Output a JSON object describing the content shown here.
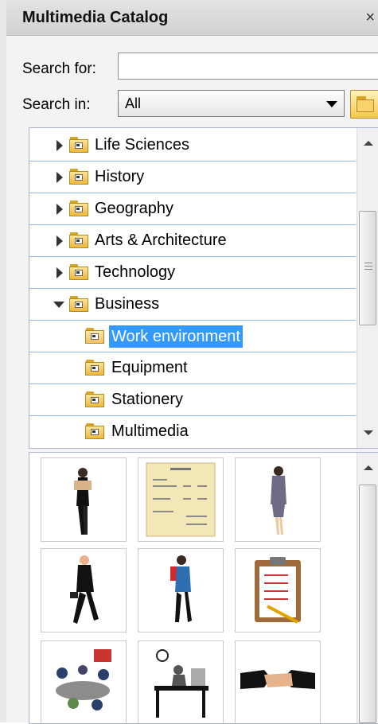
{
  "panel": {
    "title": "Multimedia Catalog",
    "close_icon": "close-icon"
  },
  "search": {
    "label": "Search for:",
    "value": "",
    "placeholder": ""
  },
  "search_in": {
    "label": "Search in:",
    "selected": "All",
    "browse_icon": "folder-icon"
  },
  "tree": {
    "items": [
      {
        "label": "Life Sciences",
        "expanded": false,
        "level": 0
      },
      {
        "label": "History",
        "expanded": false,
        "level": 0
      },
      {
        "label": "Geography",
        "expanded": false,
        "level": 0
      },
      {
        "label": "Arts & Architecture",
        "expanded": false,
        "level": 0
      },
      {
        "label": "Technology",
        "expanded": false,
        "level": 0
      },
      {
        "label": "Business",
        "expanded": true,
        "level": 0
      },
      {
        "label": "Work environment",
        "selected": true,
        "level": 1
      },
      {
        "label": "Equipment",
        "level": 1
      },
      {
        "label": "Stationery",
        "level": 1
      },
      {
        "label": "Multimedia",
        "level": 1
      }
    ]
  },
  "gallery": {
    "items": [
      {
        "icon": "woman-reading-icon"
      },
      {
        "icon": "invoice-document-icon"
      },
      {
        "icon": "businesswoman-standing-icon"
      },
      {
        "icon": "businessman-walking-icon"
      },
      {
        "icon": "woman-carrying-folders-icon"
      },
      {
        "icon": "clipboard-checklist-icon"
      },
      {
        "icon": "meeting-room-icon"
      },
      {
        "icon": "man-at-desk-icon"
      },
      {
        "icon": "handshake-icon"
      }
    ]
  },
  "colors": {
    "selection": "#3399ff",
    "tree_divider": "#8fb6e6",
    "folder": "#efb93c"
  }
}
